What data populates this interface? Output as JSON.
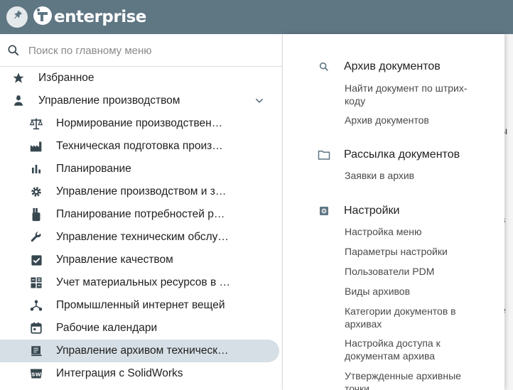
{
  "header": {
    "logo_text": "enterprise",
    "pin_icon": "pin-icon"
  },
  "search": {
    "placeholder": "Поиск по главному меню"
  },
  "menu": {
    "favorites": "Избранное",
    "production": "Управление производством",
    "sub_items": [
      {
        "label": "Нормирование производствен…",
        "icon": "scales-icon"
      },
      {
        "label": "Техническая подготовка произ…",
        "icon": "factory-icon"
      },
      {
        "label": "Планирование",
        "icon": "bar-chart-icon"
      },
      {
        "label": "Управление производством и з…",
        "icon": "gear-icon"
      },
      {
        "label": "Планирование потребностей р…",
        "icon": "hand-icon"
      },
      {
        "label": "Управление техническим обслу…",
        "icon": "wrench-icon"
      },
      {
        "label": "Управление качеством",
        "icon": "checkbox-icon"
      },
      {
        "label": "Учет материальных ресурсов в …",
        "icon": "calculator-icon"
      },
      {
        "label": "Промышленный интернет вещей",
        "icon": "network-icon"
      },
      {
        "label": "Рабочие календари",
        "icon": "calendar-icon"
      },
      {
        "label": "Управление архивом техническ…",
        "icon": "archive-book-icon"
      },
      {
        "label": "Интеграция с SolidWorks",
        "icon": "solidworks-icon"
      }
    ]
  },
  "submenu": {
    "sections": [
      {
        "title": "Архив документов",
        "icon": "search-icon",
        "links": [
          "Найти документ по штрих-кoду",
          "Архив документов"
        ]
      },
      {
        "title": "Рассылка документов",
        "icon": "folder-icon",
        "links": [
          "Заявки в архив"
        ]
      },
      {
        "title": "Настройки",
        "icon": "settings-icon",
        "links": [
          "Настройка меню",
          "Параметры настройки",
          "Пользователи PDM",
          "Виды архивов",
          "Категории документов в архивах",
          "Настройка доступа к документам архива",
          "Утвержденные архивные точки"
        ]
      }
    ]
  },
  "underlay_fragments": [
    "ы",
    "в",
    "е"
  ],
  "colors": {
    "topbar": "#5f7683",
    "active_item": "#d6dfe5",
    "icon": "#37474f"
  }
}
